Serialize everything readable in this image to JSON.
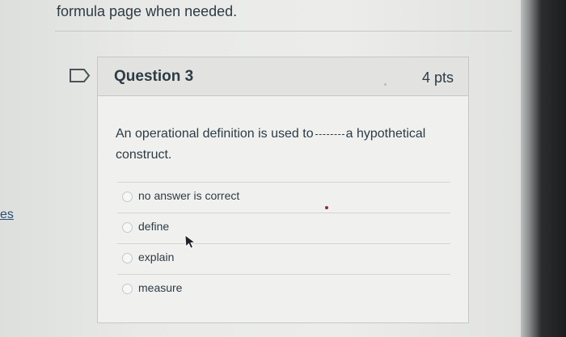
{
  "page": {
    "top_instruction": "formula page when needed.",
    "left_fragment": "es"
  },
  "question": {
    "title": "Question 3",
    "points": "4 pts",
    "text_before": "An operational definition is used to",
    "text_after": "a hypothetical construct.",
    "answers": [
      {
        "label": "no answer is correct",
        "selected": false
      },
      {
        "label": "define",
        "selected": false
      },
      {
        "label": "explain",
        "selected": false
      },
      {
        "label": "measure",
        "selected": false
      }
    ]
  },
  "icons": {
    "flag": "flag-icon",
    "radio": "radio-icon",
    "cursor": "cursor-icon"
  },
  "colors": {
    "text": "#2d3b45",
    "card_border": "#c5c7c6",
    "header_bg": "#e2e3e1"
  }
}
